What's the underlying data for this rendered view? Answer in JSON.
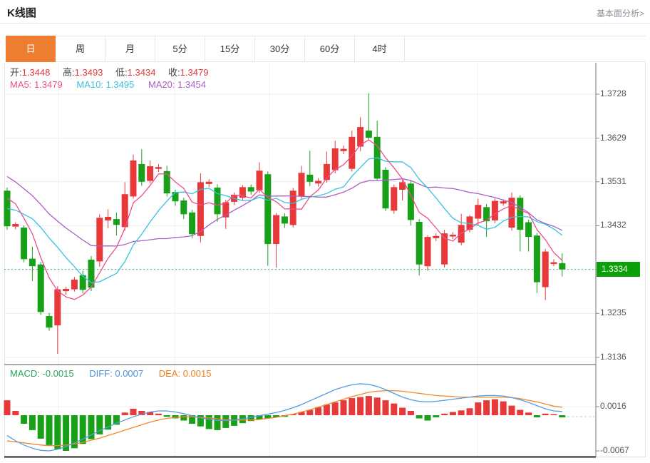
{
  "header": {
    "title": "K线图",
    "analysis_link": "基本面分析>"
  },
  "tabs": {
    "active_index": 0,
    "items": [
      {
        "key": "day",
        "label": "日"
      },
      {
        "key": "week",
        "label": "周"
      },
      {
        "key": "month",
        "label": "月"
      },
      {
        "key": "5min",
        "label": "5分"
      },
      {
        "key": "15min",
        "label": "15分"
      },
      {
        "key": "30min",
        "label": "30分"
      },
      {
        "key": "60min",
        "label": "60分"
      },
      {
        "key": "4hour",
        "label": "4时"
      }
    ]
  },
  "ohlc_row": {
    "open_label": "开:",
    "open": "1.3448",
    "high_label": "高:",
    "high": "1.3493",
    "low_label": "低:",
    "low": "1.3434",
    "close_label": "收:",
    "close": "1.3479"
  },
  "ma_row": {
    "ma5_label": "MA5:",
    "ma5": "1.3479",
    "ma10_label": "MA10:",
    "ma10": "1.3495",
    "ma20_label": "MA20:",
    "ma20": "1.3454"
  },
  "macd_row": {
    "macd_label": "MACD:",
    "macd": "-0.0015",
    "diff_label": "DIFF:",
    "diff": "0.0007",
    "dea_label": "DEA:",
    "dea": "0.0015"
  },
  "price_axis": {
    "labels": [
      "1.3728",
      "1.3629",
      "1.3531",
      "1.3432",
      "1.3334",
      "1.3235",
      "1.3136"
    ],
    "current": "1.3334"
  },
  "macd_axis": {
    "labels": [
      "0.0016",
      "-0.0067"
    ]
  },
  "colors": {
    "up": "#e8393a",
    "down": "#18a018",
    "badge": "#0ca008",
    "current_line": "#3dbd7d",
    "ma5": "#ef4e8d",
    "ma10": "#36c2dd",
    "ma20": "#aa5fc3",
    "diff_line": "#549be0",
    "dea_line": "#f0882a",
    "accent_tab": "#ed7d31"
  },
  "chart_data": {
    "type": "candlestick",
    "title": "K线图 (daily K-line with MA5/MA10/MA20 and MACD)",
    "ylim": [
      1.3136,
      1.3728
    ],
    "macd_ylim": [
      -0.0067,
      0.0016
    ],
    "current_price": 1.3334,
    "grid": true,
    "candles": [
      [
        1.3511,
        1.3518,
        1.3423,
        1.3431
      ],
      [
        1.343,
        1.344,
        1.3424,
        1.3436
      ],
      [
        1.3428,
        1.3433,
        1.335,
        1.3357
      ],
      [
        1.3358,
        1.3385,
        1.3308,
        1.3341
      ],
      [
        1.3345,
        1.3351,
        1.3232,
        1.3238
      ],
      [
        1.3229,
        1.3236,
        1.3196,
        1.3203
      ],
      [
        1.3208,
        1.3296,
        1.3144,
        1.3289
      ],
      [
        1.3285,
        1.3295,
        1.3277,
        1.329
      ],
      [
        1.3289,
        1.3317,
        1.3284,
        1.3311
      ],
      [
        1.3321,
        1.3331,
        1.328,
        1.3288
      ],
      [
        1.3356,
        1.3364,
        1.3285,
        1.3293
      ],
      [
        1.3352,
        1.3458,
        1.334,
        1.345
      ],
      [
        1.3444,
        1.3469,
        1.3426,
        1.3452
      ],
      [
        1.3447,
        1.3462,
        1.341,
        1.3434
      ],
      [
        1.3429,
        1.353,
        1.3421,
        1.3503
      ],
      [
        1.3498,
        1.3592,
        1.3493,
        1.3579
      ],
      [
        1.3571,
        1.3604,
        1.3522,
        1.3531
      ],
      [
        1.3533,
        1.3579,
        1.3528,
        1.3566
      ],
      [
        1.356,
        1.3571,
        1.3553,
        1.3564
      ],
      [
        1.3555,
        1.3567,
        1.3498,
        1.3505
      ],
      [
        1.3508,
        1.3513,
        1.3477,
        1.3487
      ],
      [
        1.3489,
        1.3495,
        1.3447,
        1.3458
      ],
      [
        1.3462,
        1.3468,
        1.3404,
        1.3413
      ],
      [
        1.3409,
        1.355,
        1.3395,
        1.353
      ],
      [
        1.3526,
        1.3537,
        1.3519,
        1.3531
      ],
      [
        1.3518,
        1.3525,
        1.3441,
        1.3458
      ],
      [
        1.3451,
        1.349,
        1.3425,
        1.3485
      ],
      [
        1.3486,
        1.3507,
        1.3479,
        1.3502
      ],
      [
        1.3495,
        1.3524,
        1.3489,
        1.3519
      ],
      [
        1.3519,
        1.3525,
        1.3502,
        1.3509
      ],
      [
        1.3512,
        1.3575,
        1.3506,
        1.3556
      ],
      [
        1.3548,
        1.3554,
        1.3342,
        1.3391
      ],
      [
        1.3391,
        1.3461,
        1.3338,
        1.3456
      ],
      [
        1.3453,
        1.346,
        1.3427,
        1.3437
      ],
      [
        1.3434,
        1.3517,
        1.3428,
        1.3511
      ],
      [
        1.3498,
        1.3567,
        1.3493,
        1.3551
      ],
      [
        1.3547,
        1.3601,
        1.3521,
        1.3531
      ],
      [
        1.3527,
        1.3539,
        1.352,
        1.3533
      ],
      [
        1.3535,
        1.3599,
        1.3529,
        1.3571
      ],
      [
        1.3557,
        1.3623,
        1.355,
        1.3606
      ],
      [
        1.36,
        1.3613,
        1.3593,
        1.3605
      ],
      [
        1.356,
        1.3646,
        1.3554,
        1.3632
      ],
      [
        1.361,
        1.3676,
        1.36,
        1.3654
      ],
      [
        1.3646,
        1.373,
        1.3624,
        1.363
      ],
      [
        1.3632,
        1.3668,
        1.3534,
        1.3538
      ],
      [
        1.3558,
        1.3564,
        1.3465,
        1.3471
      ],
      [
        1.3466,
        1.3525,
        1.3459,
        1.3519
      ],
      [
        1.3513,
        1.3535,
        1.3489,
        1.353
      ],
      [
        1.3527,
        1.3533,
        1.3433,
        1.3445
      ],
      [
        1.3441,
        1.3447,
        1.332,
        1.3345
      ],
      [
        1.3341,
        1.3411,
        1.3331,
        1.3407
      ],
      [
        1.3404,
        1.3415,
        1.3397,
        1.3409
      ],
      [
        1.3345,
        1.3423,
        1.3338,
        1.3415
      ],
      [
        1.3408,
        1.3418,
        1.3402,
        1.3412
      ],
      [
        1.3394,
        1.3459,
        1.3388,
        1.3434
      ],
      [
        1.3423,
        1.3456,
        1.3417,
        1.3453
      ],
      [
        1.3448,
        1.3493,
        1.3434,
        1.3479
      ],
      [
        1.3474,
        1.3481,
        1.3407,
        1.3442
      ],
      [
        1.3444,
        1.3494,
        1.3438,
        1.3488
      ],
      [
        1.3482,
        1.3492,
        1.3477,
        1.3487
      ],
      [
        1.3428,
        1.3507,
        1.3421,
        1.3495
      ],
      [
        1.3495,
        1.3501,
        1.3374,
        1.3423
      ],
      [
        1.344,
        1.3446,
        1.3374,
        1.3407
      ],
      [
        1.341,
        1.3416,
        1.3281,
        1.3305
      ],
      [
        1.3294,
        1.338,
        1.3265,
        1.3374
      ],
      [
        1.3346,
        1.3357,
        1.3341,
        1.335
      ],
      [
        1.3348,
        1.337,
        1.3318,
        1.3334
      ]
    ],
    "ma_seed": [
      1.368,
      1.3665,
      1.365,
      1.3638,
      1.3625,
      1.3613,
      1.36,
      1.358,
      1.356,
      1.354,
      1.347,
      1.345,
      1.344,
      1.3435,
      1.344,
      1.35,
      1.352,
      1.3515,
      1.3505
    ],
    "macd": {
      "hist": [
        0.0028,
        0.0008,
        -0.0016,
        -0.0028,
        -0.0044,
        -0.0056,
        -0.0064,
        -0.0067,
        -0.0062,
        -0.0054,
        -0.0045,
        -0.0036,
        -0.0027,
        -0.0018,
        0.0005,
        0.0012,
        0.0008,
        0.0006,
        0.0003,
        -0.0003,
        -0.0006,
        -0.001,
        -0.0016,
        -0.0021,
        -0.0026,
        -0.0028,
        -0.0024,
        -0.002,
        -0.0015,
        -0.0011,
        -0.0008,
        -0.0006,
        -0.0004,
        -0.0003,
        0.0002,
        0.0006,
        0.001,
        0.0015,
        0.002,
        0.0024,
        0.0028,
        0.0032,
        0.0034,
        0.0036,
        0.0033,
        0.0028,
        0.0022,
        0.0014,
        0.0008,
        -0.0006,
        -0.001,
        -0.0004,
        0.0003,
        0.0006,
        0.0009,
        0.0013,
        0.0024,
        0.0028,
        0.003,
        0.0026,
        0.0018,
        0.001,
        0.0005,
        -0.0004,
        0.0003,
        0.0002,
        -0.0004
      ],
      "diff": [
        -0.0038,
        -0.0048,
        -0.0056,
        -0.0062,
        -0.0066,
        -0.0067,
        -0.0064,
        -0.0059,
        -0.0052,
        -0.0045,
        -0.0037,
        -0.0029,
        -0.0022,
        -0.0015,
        -0.0009,
        -0.0003,
        0.0002,
        0.0006,
        0.0008,
        0.0008,
        0.0006,
        0.0003,
        -0.0001,
        -0.0005,
        -0.0008,
        -0.001,
        -0.001,
        -0.0009,
        -0.0007,
        -0.0004,
        -0.0001,
        0.0002,
        0.0005,
        0.0009,
        0.0014,
        0.002,
        0.0027,
        0.0034,
        0.0041,
        0.0048,
        0.0053,
        0.0057,
        0.0059,
        0.0058,
        0.0054,
        0.0048,
        0.0041,
        0.0034,
        0.0029,
        0.0026,
        0.0025,
        0.0026,
        0.0028,
        0.003,
        0.0032,
        0.0034,
        0.0036,
        0.0037,
        0.0037,
        0.0036,
        0.0033,
        0.0029,
        0.0024,
        0.0018,
        0.0012,
        0.0008,
        0.0007
      ],
      "dea": [
        -0.0048,
        -0.005,
        -0.0052,
        -0.0054,
        -0.0056,
        -0.0057,
        -0.0057,
        -0.0056,
        -0.0054,
        -0.0051,
        -0.0047,
        -0.0043,
        -0.0038,
        -0.0033,
        -0.0028,
        -0.0023,
        -0.0018,
        -0.0013,
        -0.0009,
        -0.0006,
        -0.0004,
        -0.0003,
        -0.0003,
        -0.0004,
        -0.0005,
        -0.0007,
        -0.0008,
        -0.0009,
        -0.0009,
        -0.0009,
        -0.0008,
        -0.0006,
        -0.0004,
        -0.0001,
        0.0002,
        0.0006,
        0.001,
        0.0015,
        0.002,
        0.0025,
        0.003,
        0.0035,
        0.0039,
        0.0043,
        0.0045,
        0.0046,
        0.0046,
        0.0045,
        0.0043,
        0.0041,
        0.0039,
        0.0037,
        0.0036,
        0.0035,
        0.0034,
        0.0034,
        0.0034,
        0.0034,
        0.0034,
        0.0034,
        0.0033,
        0.0031,
        0.0028,
        0.0025,
        0.0021,
        0.0017,
        0.0015
      ]
    }
  }
}
